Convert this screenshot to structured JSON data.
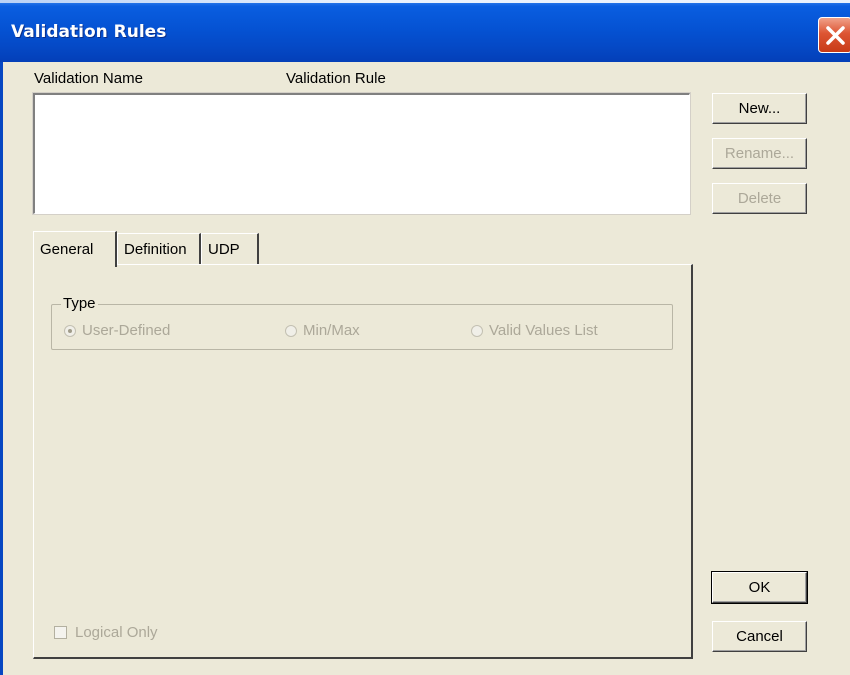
{
  "window": {
    "title": "Validation Rules"
  },
  "list": {
    "columns": [
      "Validation Name",
      "Validation Rule"
    ],
    "rows": []
  },
  "side_buttons": {
    "new_label": "New...",
    "rename_label": "Rename...",
    "delete_label": "Delete"
  },
  "tabs": [
    {
      "label": "General",
      "active": true
    },
    {
      "label": "Definition",
      "active": false
    },
    {
      "label": "UDP",
      "active": false
    }
  ],
  "general": {
    "type_group_label": "Type",
    "type_options": [
      {
        "label": "User-Defined",
        "selected": true,
        "enabled": false
      },
      {
        "label": "Min/Max",
        "selected": false,
        "enabled": false
      },
      {
        "label": "Valid Values List",
        "selected": false,
        "enabled": false
      }
    ],
    "logical_only_label": "Logical Only",
    "logical_only_checked": false
  },
  "footer_buttons": {
    "ok_label": "OK",
    "cancel_label": "Cancel"
  },
  "colors": {
    "titlebar": "#0553d4",
    "dialog_bg": "#ece9d8",
    "close_button": "#dd5533",
    "disabled_text": "#aca899"
  }
}
